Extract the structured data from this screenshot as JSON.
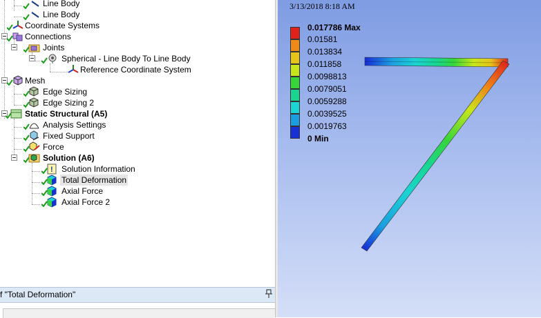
{
  "tree": {
    "items": [
      {
        "label": "Line Body",
        "level": 2,
        "icon": "line-body-icon",
        "bold": false,
        "selected": false
      },
      {
        "label": "Line Body",
        "level": 2,
        "icon": "line-body-icon",
        "bold": false,
        "selected": false
      },
      {
        "label": "Coordinate Systems",
        "level": 1,
        "icon": "coordinate-systems-icon",
        "bold": false,
        "selected": false
      },
      {
        "label": "Connections",
        "level": 1,
        "icon": "connections-icon",
        "bold": false,
        "selected": false
      },
      {
        "label": "Joints",
        "level": 2,
        "icon": "joints-folder-icon",
        "bold": false,
        "selected": false
      },
      {
        "label": "Spherical - Line Body To Line Body",
        "level": 3,
        "icon": "spherical-joint-icon",
        "bold": false,
        "selected": false
      },
      {
        "label": "Reference Coordinate System",
        "level": 4,
        "icon": "reference-coordinate-system-icon",
        "bold": false,
        "selected": false
      },
      {
        "label": "Mesh",
        "level": 1,
        "icon": "mesh-icon",
        "bold": false,
        "selected": false
      },
      {
        "label": "Edge Sizing",
        "level": 2,
        "icon": "edge-sizing-icon",
        "bold": false,
        "selected": false
      },
      {
        "label": "Edge Sizing 2",
        "level": 2,
        "icon": "edge-sizing-icon",
        "bold": false,
        "selected": false
      },
      {
        "label": "Static Structural (A5)",
        "level": 1,
        "icon": "static-structural-icon",
        "bold": true,
        "selected": false
      },
      {
        "label": "Analysis Settings",
        "level": 2,
        "icon": "analysis-settings-icon",
        "bold": false,
        "selected": false
      },
      {
        "label": "Fixed Support",
        "level": 2,
        "icon": "fixed-support-icon",
        "bold": false,
        "selected": false
      },
      {
        "label": "Force",
        "level": 2,
        "icon": "force-icon",
        "bold": false,
        "selected": false
      },
      {
        "label": "Solution (A6)",
        "level": 2,
        "icon": "solution-icon",
        "bold": true,
        "selected": false
      },
      {
        "label": "Solution Information",
        "level": 3,
        "icon": "solution-information-icon",
        "bold": false,
        "selected": false
      },
      {
        "label": "Total Deformation",
        "level": 3,
        "icon": "total-deformation-icon",
        "bold": false,
        "selected": true
      },
      {
        "label": "Axial Force",
        "level": 3,
        "icon": "axial-force-icon",
        "bold": false,
        "selected": false
      },
      {
        "label": "Axial Force 2",
        "level": 3,
        "icon": "axial-force-icon",
        "bold": false,
        "selected": false
      }
    ]
  },
  "details": {
    "title": "f \"Total Deformation\"",
    "pin_icon": "pin-icon"
  },
  "viewport": {
    "timestamp": "3/13/2018 8:18 AM",
    "legend": {
      "max_label": "0.017786 Max",
      "min_label": "0 Min",
      "values": [
        "0.015810",
        "0.013834",
        "0.011858",
        "0.0098813",
        "0.0079051",
        "0.0059288",
        "0.0039525",
        "0.0019763"
      ],
      "display_values": [
        "0.01581",
        "0.013834",
        "0.011858",
        "0.0098813",
        "0.0079051",
        "0.0059288",
        "0.0039525",
        "0.0019763"
      ],
      "colors": [
        "#e0221b",
        "#ee8a17",
        "#e6c41a",
        "#c9e61a",
        "#36d63a",
        "#18d68f",
        "#1bd4d3",
        "#1b9ee0",
        "#1831d6"
      ]
    }
  },
  "colors": {
    "accent_check": "#18a018",
    "viewport_top": "#7f9ce3",
    "viewport_bottom": "#d4def7",
    "selection": "#e5e5e5"
  }
}
